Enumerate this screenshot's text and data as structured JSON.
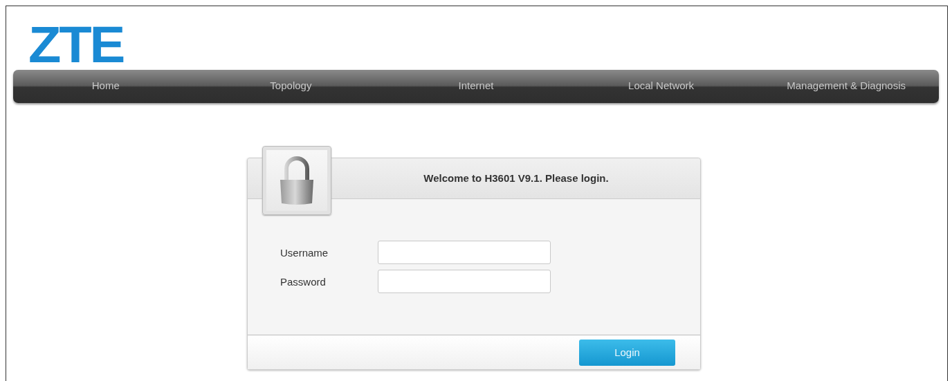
{
  "logo": "ZTE",
  "nav": [
    {
      "label": "Home"
    },
    {
      "label": "Topology"
    },
    {
      "label": "Internet"
    },
    {
      "label": "Local Network"
    },
    {
      "label": "Management & Diagnosis"
    }
  ],
  "login": {
    "title": "Welcome to H3601 V9.1. Please login.",
    "fields": [
      {
        "label": "Username"
      },
      {
        "label": "Password"
      }
    ],
    "button": "Login"
  }
}
